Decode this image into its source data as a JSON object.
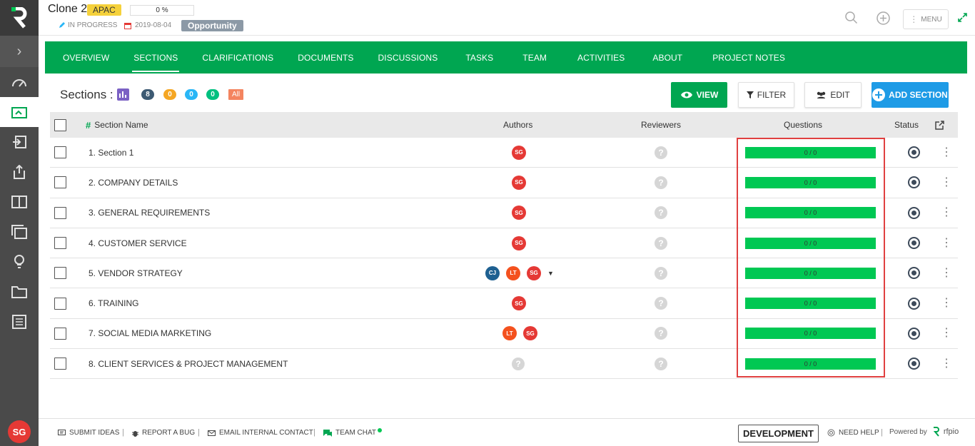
{
  "header": {
    "title": "Clone 2",
    "region": "APAC",
    "progress": "0 %",
    "status": "IN PROGRESS",
    "date": "2019-08-04",
    "type": "Opportunity",
    "menu_label": "MENU"
  },
  "nav": {
    "tabs": [
      "OVERVIEW",
      "SECTIONS",
      "CLARIFICATIONS",
      "DOCUMENTS",
      "DISCUSSIONS",
      "TASKS",
      "TEAM",
      "ACTIVITIES",
      "ABOUT",
      "PROJECT NOTES"
    ],
    "active": "SECTIONS"
  },
  "toolbar": {
    "sections_label": "Sections :",
    "counts": [
      {
        "value": "8",
        "color": "#3d5a73"
      },
      {
        "value": "0",
        "color": "#f5a623"
      },
      {
        "value": "0",
        "color": "#29b6f6"
      },
      {
        "value": "0",
        "color": "#00c07f"
      }
    ],
    "all_label": "All",
    "view_label": "VIEW",
    "filter_label": "FILTER",
    "edit_label": "EDIT",
    "add_label": "ADD SECTION"
  },
  "table": {
    "headers": {
      "name": "Section Name",
      "authors": "Authors",
      "reviewers": "Reviewers",
      "questions": "Questions",
      "status": "Status"
    },
    "rows": [
      {
        "name": "1. Section 1",
        "authors": [
          "SG"
        ],
        "questions": "0 / 0"
      },
      {
        "name": "2. COMPANY DETAILS",
        "authors": [
          "SG"
        ],
        "questions": "0 / 0"
      },
      {
        "name": "3. GENERAL REQUIREMENTS",
        "authors": [
          "SG"
        ],
        "questions": "0 / 0"
      },
      {
        "name": "4. CUSTOMER SERVICE",
        "authors": [
          "SG"
        ],
        "questions": "0 / 0"
      },
      {
        "name": "5. VENDOR STRATEGY",
        "authors": [
          "CJ",
          "LT",
          "SG"
        ],
        "more": true,
        "questions": "0 / 0"
      },
      {
        "name": "6. TRAINING",
        "authors": [
          "SG"
        ],
        "questions": "0 / 0"
      },
      {
        "name": "7. SOCIAL MEDIA MARKETING",
        "authors": [
          "LT",
          "SG"
        ],
        "questions": "0 / 0"
      },
      {
        "name": "8. CLIENT SERVICES & PROJECT MANAGEMENT",
        "authors": [],
        "questions": "0 / 0"
      }
    ],
    "avatar_colors": {
      "SG": "#e53935",
      "LT": "#f4511e",
      "CJ": "#1e6091"
    }
  },
  "footer": {
    "submit_ideas": "SUBMIT IDEAS",
    "report_bug": "REPORT A BUG",
    "email_contact": "EMAIL INTERNAL CONTACT",
    "team_chat": "TEAM CHAT",
    "environment": "DEVELOPMENT",
    "need_help": "NEED HELP",
    "powered_by": "Powered by",
    "brand": "rfpio"
  },
  "user": {
    "initials": "SG"
  }
}
